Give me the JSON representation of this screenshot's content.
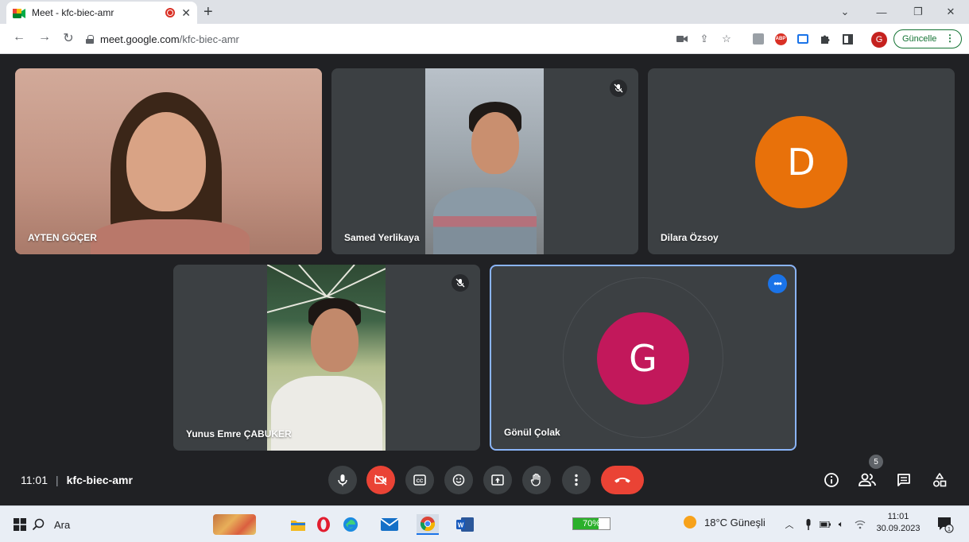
{
  "browser": {
    "tab_title": "Meet - kfc-biec-amr",
    "url_host": "meet.google.com",
    "url_path": "/kfc-biec-amr",
    "profile_initial": "G",
    "update_label": "Güncelle"
  },
  "participants": [
    {
      "name": "AYTEN GÖÇER",
      "camera": "on",
      "muted": false
    },
    {
      "name": "Samed Yerlikaya",
      "camera": "on",
      "muted": true
    },
    {
      "name": "Dilara Özsoy",
      "camera": "off",
      "avatar_initial": "D",
      "avatar_color": "#e8710a"
    },
    {
      "name": "Yunus Emre ÇABUKER",
      "camera": "on",
      "muted": true
    },
    {
      "name": "Gönül Çolak",
      "camera": "off",
      "avatar_initial": "G",
      "avatar_color": "#c2185b",
      "active_speaker": true
    }
  ],
  "meeting": {
    "time": "11:01",
    "code": "kfc-biec-amr",
    "participant_count": "5"
  },
  "taskbar": {
    "search_placeholder": "Ara",
    "progress_label": "70%",
    "progress_value": 0.7,
    "weather": "18°C Güneşli",
    "clock_time": "11:01",
    "clock_date": "30.09.2023",
    "notification_count": "1"
  },
  "colors": {
    "meet_bg": "#202124",
    "tile_bg": "#3c4043",
    "hangup": "#ea4335",
    "active_border": "#8ab4f8"
  }
}
